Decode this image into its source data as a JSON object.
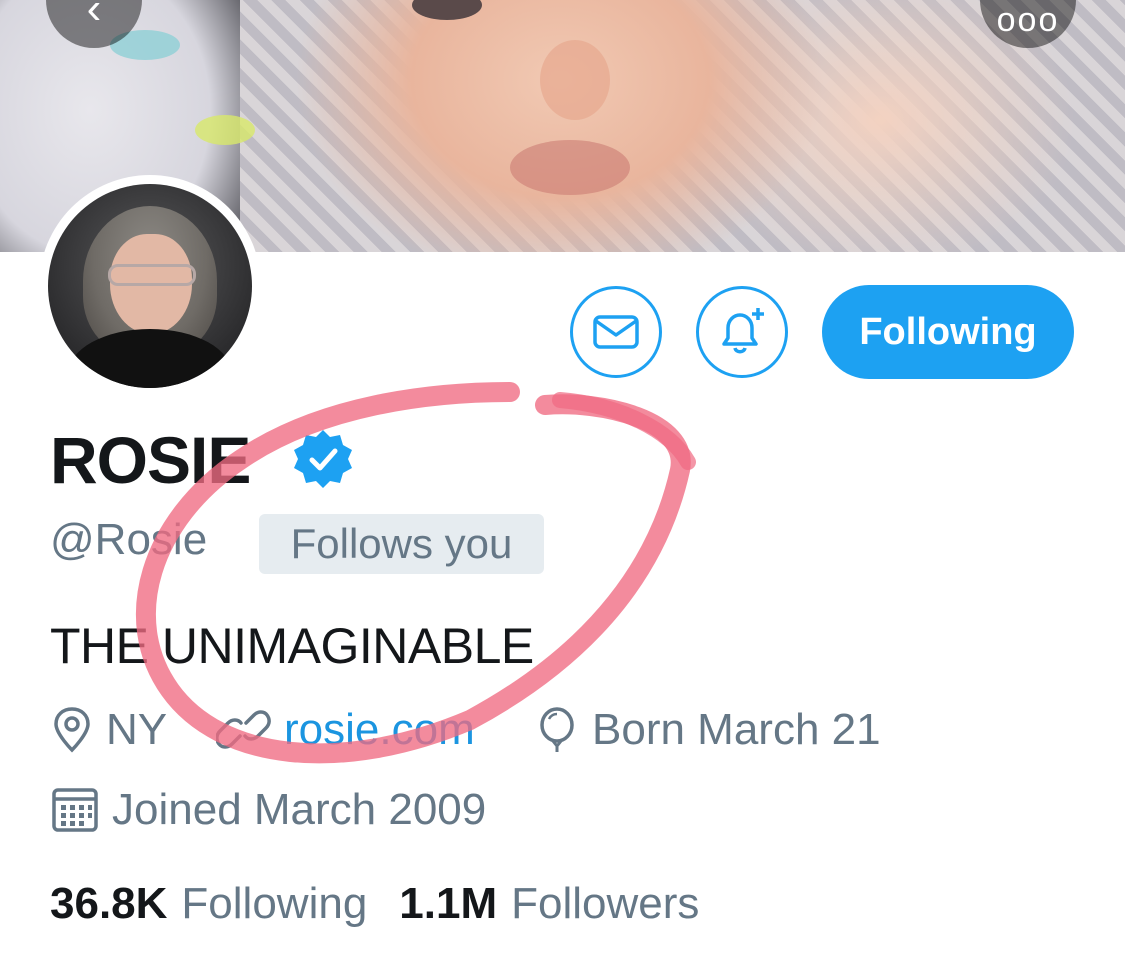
{
  "profile": {
    "display_name": "ROSIE",
    "handle": "@Rosie",
    "follows_you_label": "Follows you",
    "bio": "THE UNIMAGINABLE",
    "location": "NY",
    "website": "rosie.com",
    "birthday": "Born March 21",
    "joined": "Joined March 2009"
  },
  "stats": {
    "following_count": "36.8K",
    "following_label": "Following",
    "followers_count": "1.1M",
    "followers_label": "Followers"
  },
  "actions": {
    "following_button_label": "Following"
  },
  "icons": {
    "back": "chevron-left-icon",
    "more": "more-dots-icon",
    "message": "envelope-icon",
    "notify": "bell-plus-icon",
    "verified": "verified-badge-icon",
    "location": "map-pin-icon",
    "website": "link-icon",
    "birthday": "balloon-icon",
    "joined": "calendar-icon"
  },
  "colors": {
    "accent": "#1da1f2",
    "link": "#1b95e0",
    "secondary_text": "#657786",
    "primary_text": "#14171a",
    "badge_bg": "#e6ecf0",
    "annotation": "#f06a82"
  }
}
